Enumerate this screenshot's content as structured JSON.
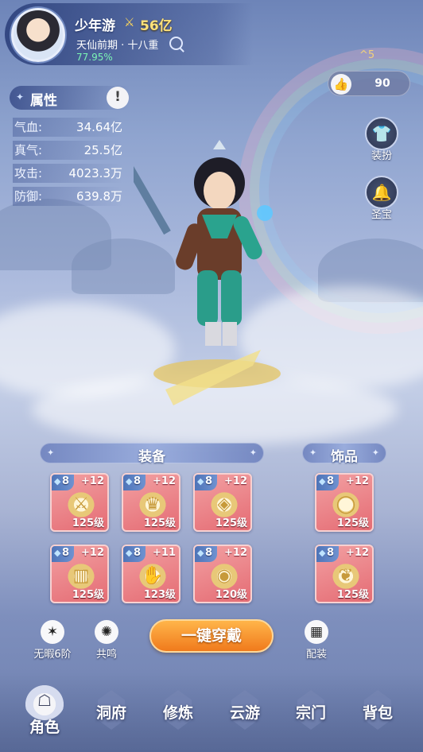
{
  "player": {
    "name": "少年游",
    "power": "56亿",
    "realm": "天仙前期 · 十八重",
    "progress": "77.95%",
    "power_icon": "crossed-swords-icon"
  },
  "stars": "^5",
  "likes": {
    "count": "90",
    "icon": "thumbs-up-icon"
  },
  "side_buttons": [
    {
      "label": "装扮",
      "icon": "robe-icon"
    },
    {
      "label": "圣宝",
      "icon": "bell-icon"
    }
  ],
  "attributes": {
    "title": "属性",
    "info": "!",
    "rows": [
      {
        "key": "气血:",
        "value": "34.64亿"
      },
      {
        "key": "真气:",
        "value": "25.5亿"
      },
      {
        "key": "攻击:",
        "value": "4023.3万"
      },
      {
        "key": "防御:",
        "value": "639.8万"
      }
    ]
  },
  "sections": {
    "equipment": "装备",
    "accessories": "饰品"
  },
  "equipment": [
    {
      "level": "8",
      "plus": "+12",
      "tier": "125级",
      "icon": "sword-icon"
    },
    {
      "level": "8",
      "plus": "+12",
      "tier": "125级",
      "icon": "helmet-icon"
    },
    {
      "level": "8",
      "plus": "+12",
      "tier": "125级",
      "icon": "armor-icon"
    },
    {
      "level": "8",
      "plus": "+12",
      "tier": "125级",
      "icon": "skirt-armor-icon"
    },
    {
      "level": "8",
      "plus": "+11",
      "tier": "123级",
      "icon": "gauntlet-icon"
    },
    {
      "level": "8",
      "plus": "+12",
      "tier": "120级",
      "icon": "boots-icon"
    }
  ],
  "accessories": [
    {
      "level": "8",
      "plus": "+12",
      "tier": "125级",
      "icon": "ring-icon"
    },
    {
      "level": "8",
      "plus": "+12",
      "tier": "125级",
      "icon": "necklace-icon"
    }
  ],
  "actions": {
    "flawless": "无暇6阶",
    "resonance": "共鸣",
    "one_key_equip": "一键穿戴",
    "outfit": "配装"
  },
  "nav": [
    "角色",
    "洞府",
    "修炼",
    "云游",
    "宗门",
    "背包"
  ],
  "colors": {
    "accent_orange": "#f07a1c",
    "slot_red": "#e56c74",
    "progress_green": "#7bf5b5",
    "power_gold": "#ffe27a"
  }
}
